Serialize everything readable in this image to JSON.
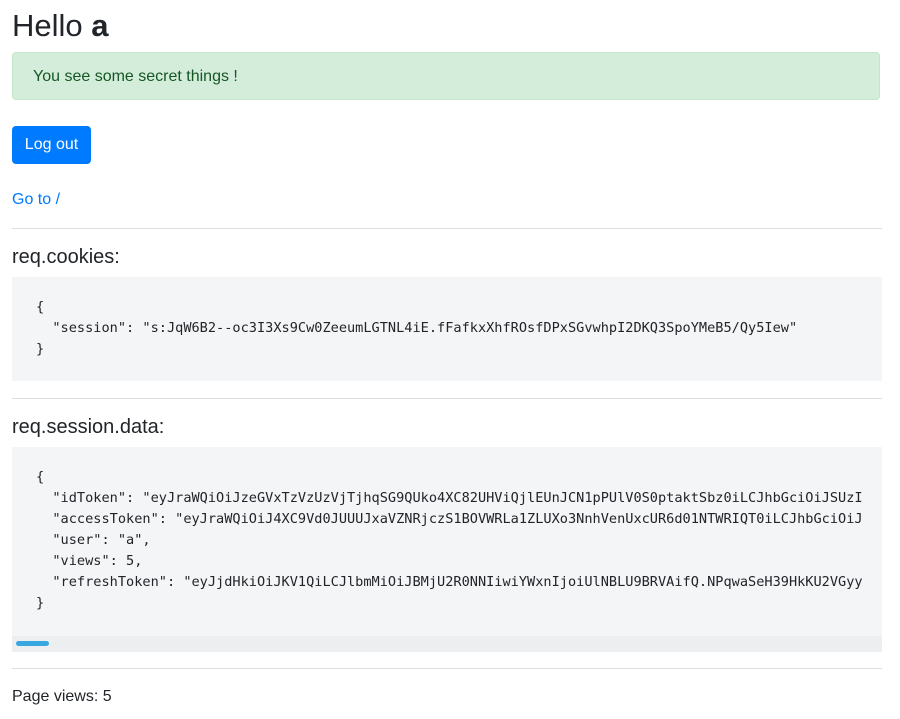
{
  "header": {
    "greeting": "Hello ",
    "username": "a"
  },
  "alert": {
    "message": "You see some secret things !",
    "color": "#d4edda"
  },
  "actions": {
    "logout_label": "Log out",
    "goto_label": "Go to /"
  },
  "cookies": {
    "title": "req.cookies:",
    "lines": [
      "{",
      "  \"session\": \"s:JqW6B2--oc3I3Xs9Cw0ZeeumLGTNL4iE.fFafkxXhfROsfDPxSGvwhpI2DKQ3SpoYMeB5/Qy5Iew\"",
      "}"
    ]
  },
  "session": {
    "title": "req.session.data:",
    "lines": [
      "{",
      "  \"idToken\": \"eyJraWQiOiJzeGVxTzVzUzVjTjhqSG9QUko4XC82UHViQjlEUnJCN1pPUlV0S0ptaktSbz0iLCJhbGciOiJSUzI",
      "  \"accessToken\": \"eyJraWQiOiJ4XC9Vd0JUUUJxaVZNRjczS1BOVWRLa1ZLUXo3NnhVenUxcUR6d01NTWRIQT0iLCJhbGciOiJ",
      "  \"user\": \"a\",",
      "  \"views\": 5,",
      "  \"refreshToken\": \"eyJjdHkiOiJKV1QiLCJlbmMiOiJBMjU2R0NNIiwiYWxnIjoiUlNBLU9BRVAifQ.NPqwaSeH39HkKU2VGyy",
      "}"
    ]
  },
  "footer": {
    "page_views": "Page views: 5"
  },
  "colors": {
    "primary": "#007bff",
    "alert_text": "#155724",
    "code_bg": "#f4f5f7",
    "scroll_thumb": "#38a8e0"
  }
}
